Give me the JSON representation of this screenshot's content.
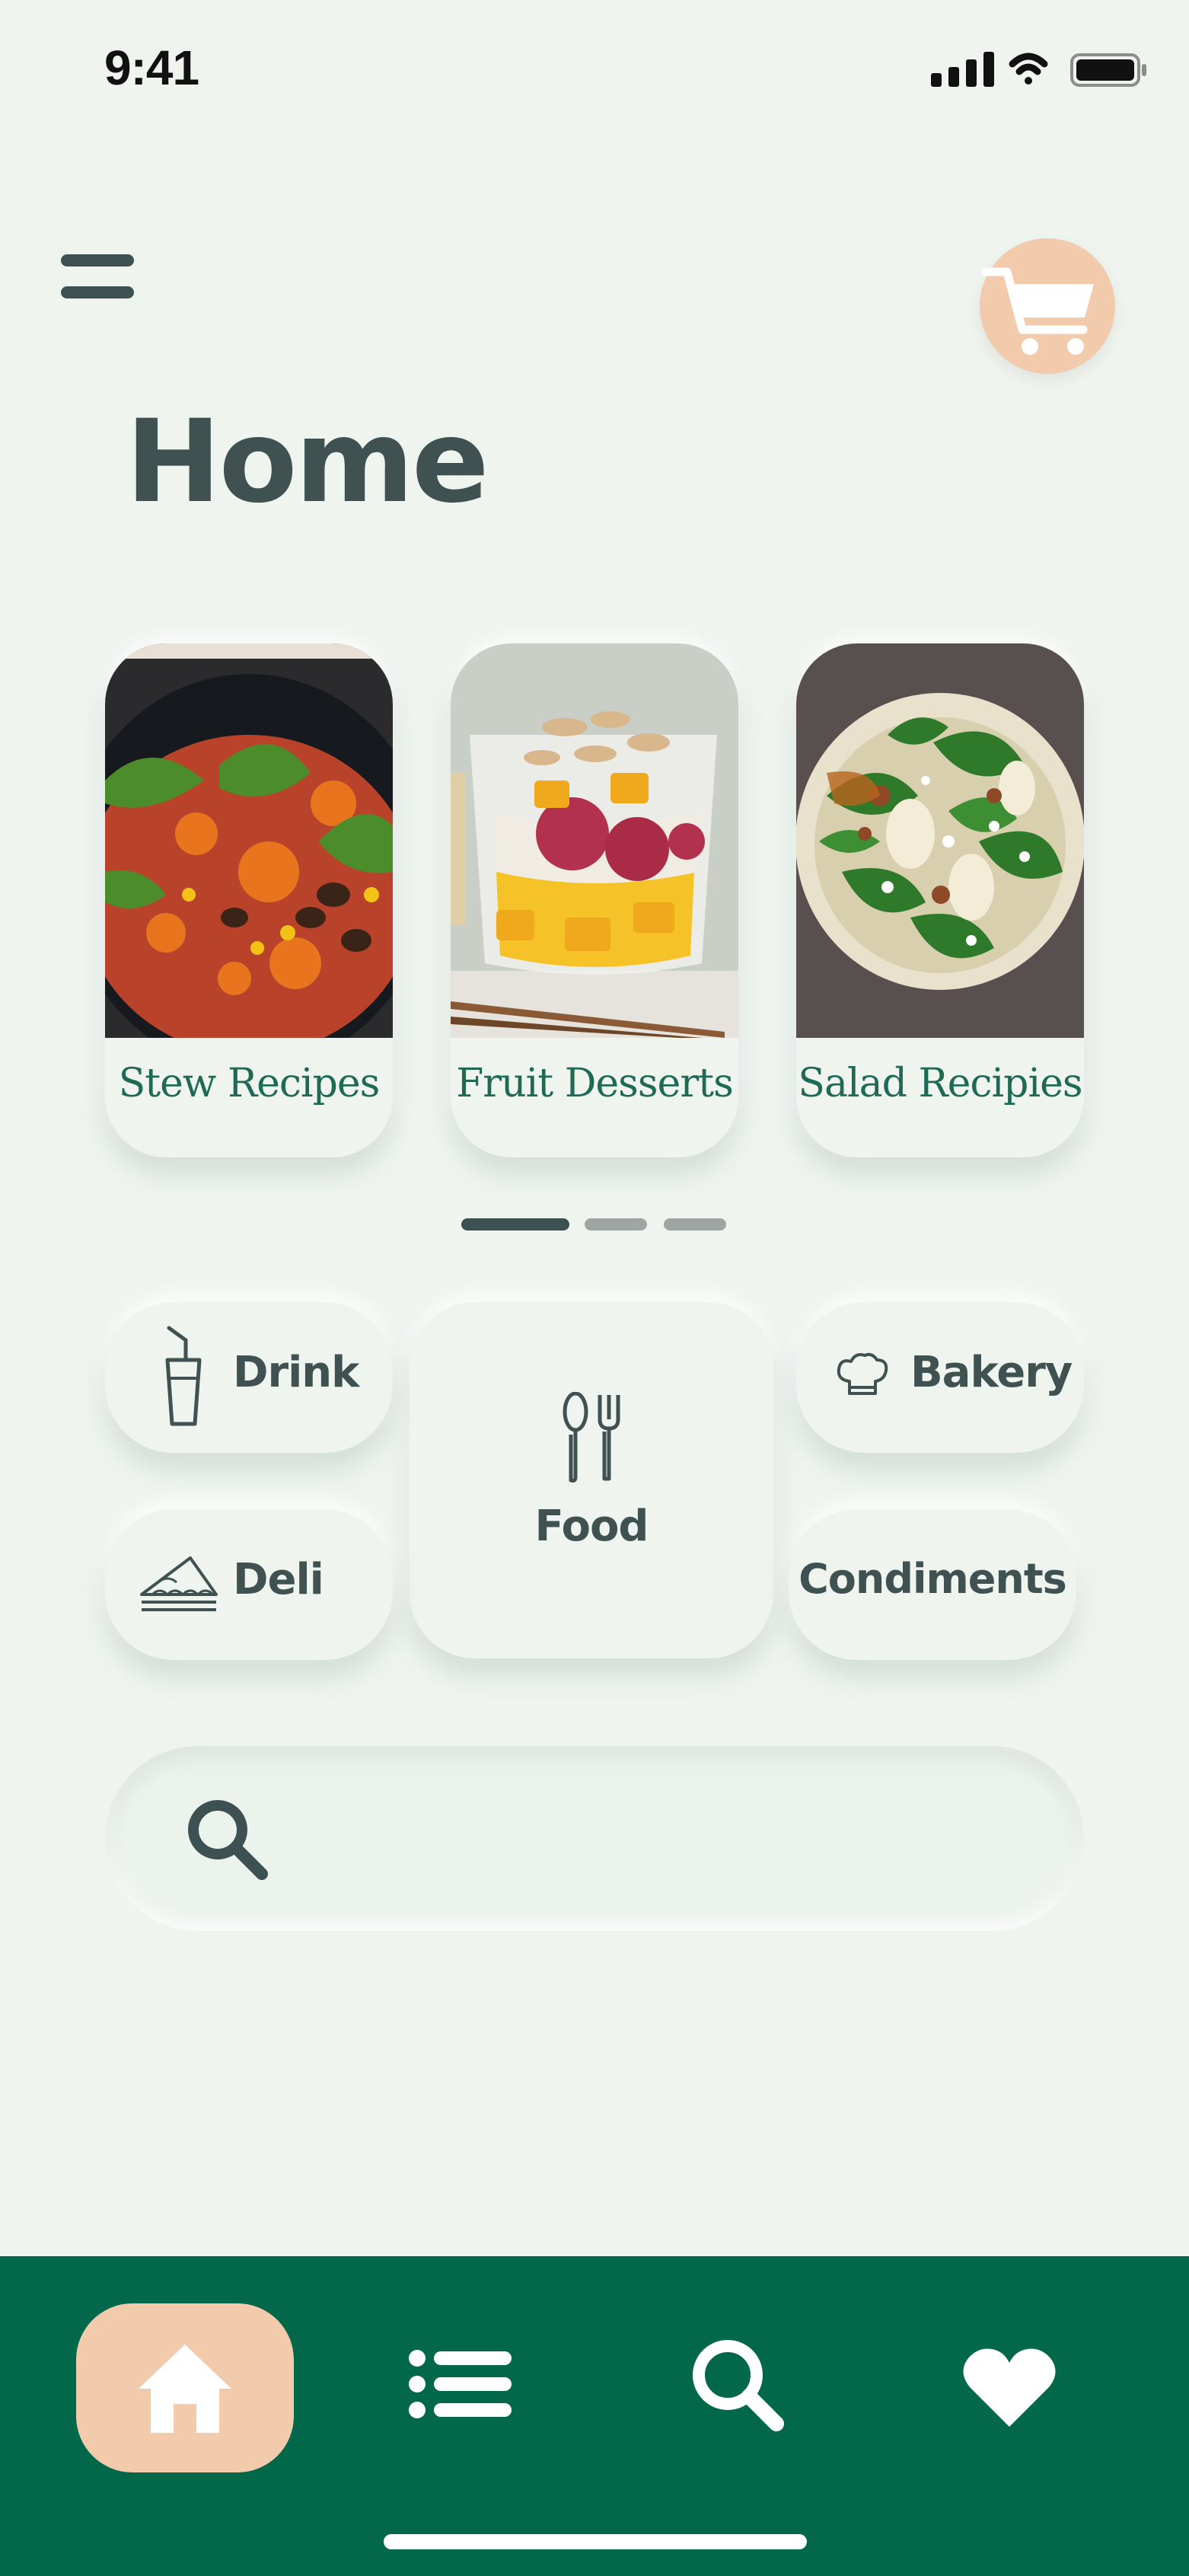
{
  "status_bar": {
    "time": "9:41",
    "icons": [
      "signal-icon",
      "wifi-icon",
      "battery-icon"
    ]
  },
  "header": {
    "menu_icon": "menu-icon",
    "cart_icon": "cart-icon",
    "title": "Home"
  },
  "categories": [
    {
      "label": "Stew Recipes",
      "image": "stew-photo"
    },
    {
      "label": "Fruit Desserts",
      "image": "fruit-dessert-photo"
    },
    {
      "label": "Salad Recipies",
      "image": "salad-photo"
    }
  ],
  "pager": {
    "count": 3,
    "active_index": 0
  },
  "quick_links": {
    "drink": "Drink",
    "bakery": "Bakery",
    "food": "Food",
    "deli": "Deli",
    "condiments": "Condiments"
  },
  "search": {
    "placeholder": "",
    "icon": "search-icon"
  },
  "bottom_nav": {
    "items": [
      "home-icon",
      "list-icon",
      "search-icon",
      "heart-icon"
    ],
    "active": "home-icon"
  },
  "colors": {
    "background": "#eff4ef",
    "text": "#3f5151",
    "accent": "#f1cbab",
    "brand_green": "#03674a",
    "label_green": "#1f6a55"
  }
}
